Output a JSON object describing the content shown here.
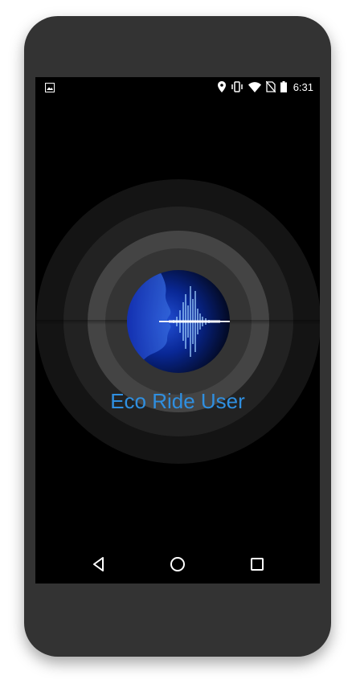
{
  "status_bar": {
    "time": "6:31",
    "icons": [
      "image-notification-icon",
      "location-icon",
      "vibrate-icon",
      "wifi-icon",
      "no-sim-icon",
      "battery-icon"
    ]
  },
  "app": {
    "name": "Eco Ride User",
    "accent_color": "#2f8fe0",
    "logo_icon": "voice-wave-logo"
  },
  "nav_bar": {
    "buttons": [
      "back",
      "home",
      "recents"
    ]
  }
}
